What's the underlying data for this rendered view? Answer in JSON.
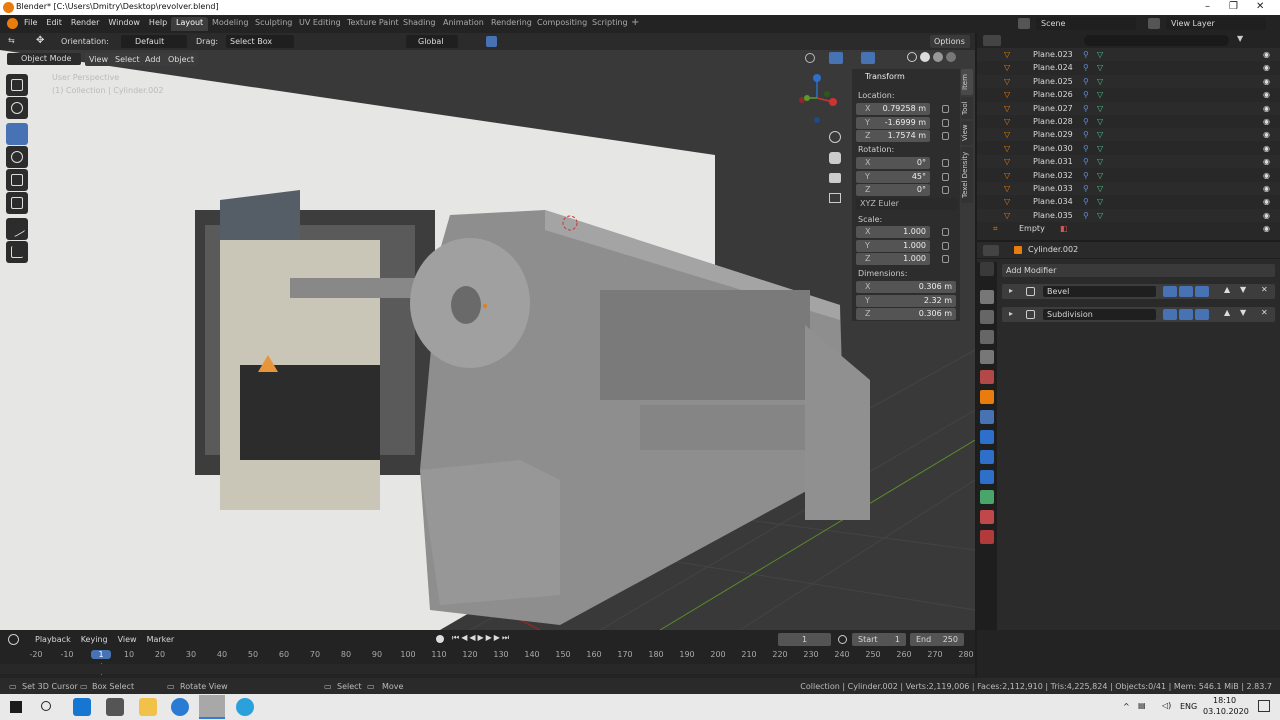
{
  "window": {
    "title": "Blender* [C:\\Users\\Dmitry\\Desktop\\revolver.blend]"
  },
  "menu": [
    "File",
    "Edit",
    "Render",
    "Window",
    "Help"
  ],
  "workspaces": [
    "Layout",
    "Modeling",
    "Sculpting",
    "UV Editing",
    "Texture Paint",
    "Shading",
    "Animation",
    "Rendering",
    "Compositing",
    "Scripting"
  ],
  "active_workspace": "Layout",
  "scene": {
    "scene_label": "Scene",
    "view_layer_label": "View Layer"
  },
  "header": {
    "orientation_label": "Orientation:",
    "orientation_value": "Default",
    "drag_label": "Drag:",
    "drag_value": "Select Box",
    "transform_space": "Global",
    "options": "Options"
  },
  "viewport_header": {
    "mode": "Object Mode",
    "view": "View",
    "select": "Select",
    "add": "Add",
    "object": "Object"
  },
  "viewport": {
    "perspective": "User Perspective",
    "collection": "(1) Collection | Cylinder.002"
  },
  "npanel": {
    "title": "Transform",
    "location_label": "Location:",
    "location": [
      {
        "axis": "X",
        "value": "0.79258 m"
      },
      {
        "axis": "Y",
        "value": "-1.6999 m"
      },
      {
        "axis": "Z",
        "value": "1.7574 m"
      }
    ],
    "rotation_label": "Rotation:",
    "rotation": [
      {
        "axis": "X",
        "value": "0°"
      },
      {
        "axis": "Y",
        "value": "45°"
      },
      {
        "axis": "Z",
        "value": "0°"
      }
    ],
    "rotation_mode": "XYZ Euler",
    "scale_label": "Scale:",
    "scale": [
      {
        "axis": "X",
        "value": "1.000"
      },
      {
        "axis": "Y",
        "value": "1.000"
      },
      {
        "axis": "Z",
        "value": "1.000"
      }
    ],
    "dimensions_label": "Dimensions:",
    "dimensions": [
      {
        "axis": "X",
        "value": "0.306 m"
      },
      {
        "axis": "Y",
        "value": "2.32 m"
      },
      {
        "axis": "Z",
        "value": "0.306 m"
      }
    ],
    "tabs": [
      "Item",
      "Tool",
      "View",
      "Texel Density"
    ]
  },
  "outliner": {
    "items": [
      "Plane.023",
      "Plane.024",
      "Plane.025",
      "Plane.026",
      "Plane.027",
      "Plane.028",
      "Plane.029",
      "Plane.030",
      "Plane.031",
      "Plane.032",
      "Plane.033",
      "Plane.034",
      "Plane.035"
    ],
    "empty": "Empty"
  },
  "properties": {
    "object": "Cylinder.002",
    "add_modifier": "Add Modifier",
    "modifiers": [
      "Bevel",
      "Subdivision"
    ]
  },
  "timeline": {
    "menus": [
      "Playback",
      "Keying",
      "View",
      "Marker"
    ],
    "current_frame": "1",
    "start_label": "Start",
    "start": "1",
    "end_label": "End",
    "end": "250",
    "ticks": [
      "-20",
      "-10",
      "1",
      "10",
      "20",
      "30",
      "40",
      "50",
      "60",
      "70",
      "80",
      "90",
      "100",
      "110",
      "120",
      "130",
      "140",
      "150",
      "160",
      "170",
      "180",
      "190",
      "200",
      "210",
      "220",
      "230",
      "240",
      "250",
      "260",
      "270",
      "280"
    ]
  },
  "statusbar": {
    "select_cursor": "Set 3D Cursor",
    "box_select": "Box Select",
    "rotate_view": "Rotate View",
    "select": "Select",
    "move": "Move",
    "stats": "Collection | Cylinder.002 | Verts:2,119,006 | Faces:2,112,910 | Tris:4,225,824 | Objects:0/41 | Mem: 546.1 MiB | 2.83.7"
  },
  "taskbar": {
    "lang": "ENG",
    "time": "18:10",
    "date": "03.10.2020"
  },
  "colors": {
    "accent": "#4772b3",
    "orange": "#e87d0d",
    "bg": "#1d1d1d"
  }
}
